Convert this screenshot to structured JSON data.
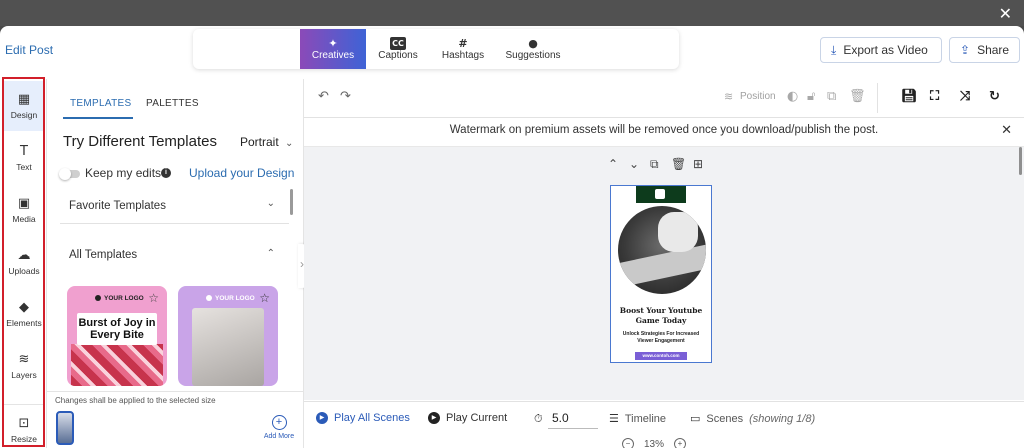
{
  "window": {
    "close_icon": "close-icon"
  },
  "header": {
    "title": "Edit Post",
    "tabs": [
      {
        "label": "Creatives",
        "icon": "magic-wand-icon",
        "glyph": "✦",
        "active": true
      },
      {
        "label": "Captions",
        "icon": "cc-icon",
        "glyph": "CC"
      },
      {
        "label": "Hashtags",
        "icon": "hashtag-icon",
        "glyph": "#"
      },
      {
        "label": "Suggestions",
        "icon": "lightbulb-icon",
        "glyph": "●"
      }
    ],
    "export_label": "Export as Video",
    "share_label": "Share"
  },
  "rail": {
    "items": [
      {
        "label": "Design",
        "icon": "design-icon",
        "active": true
      },
      {
        "label": "Text",
        "icon": "text-icon"
      },
      {
        "label": "Media",
        "icon": "media-icon"
      },
      {
        "label": "Uploads",
        "icon": "upload-cloud-icon"
      },
      {
        "label": "Elements",
        "icon": "elements-icon"
      },
      {
        "label": "Layers",
        "icon": "layers-icon"
      },
      {
        "label": "Resize",
        "icon": "resize-icon"
      }
    ]
  },
  "panel": {
    "tabs": [
      "TEMPLATES",
      "PALETTES"
    ],
    "heading": "Try Different Templates",
    "orientation": "Portrait",
    "keep_edits_label": "Keep my edits",
    "upload_link": "Upload your Design",
    "favorite_label": "Favorite Templates",
    "all_label": "All Templates",
    "templates": [
      {
        "logo": "YOUR LOGO",
        "text": "Burst of Joy in Every Bite"
      },
      {
        "logo": "YOUR LOGO",
        "text": ""
      }
    ],
    "footer_note": "Changes shall be applied to the selected size",
    "add_more": "Add More"
  },
  "toolbar": {
    "position_label": "Position"
  },
  "notice": "Watermark on premium assets will be removed once you download/publish the post.",
  "design_preview": {
    "title": "Boost Your Youtube Game Today",
    "subtitle": "Unlock Strategies For Increased Viewer Engagement",
    "url": "www.contoh.com"
  },
  "playback": {
    "play_all": "Play All Scenes",
    "play_current": "Play Current",
    "duration": "5.0",
    "timeline": "Timeline",
    "scenes": "Scenes",
    "scenes_count": "(showing 1/8)",
    "zoom": "13%"
  },
  "colors": {
    "accent": "#2b6cb0",
    "active_tab_gradient_start": "#8b4ab8",
    "active_tab_gradient_end": "#3e63d6",
    "highlight_box": "#d21f2a"
  }
}
